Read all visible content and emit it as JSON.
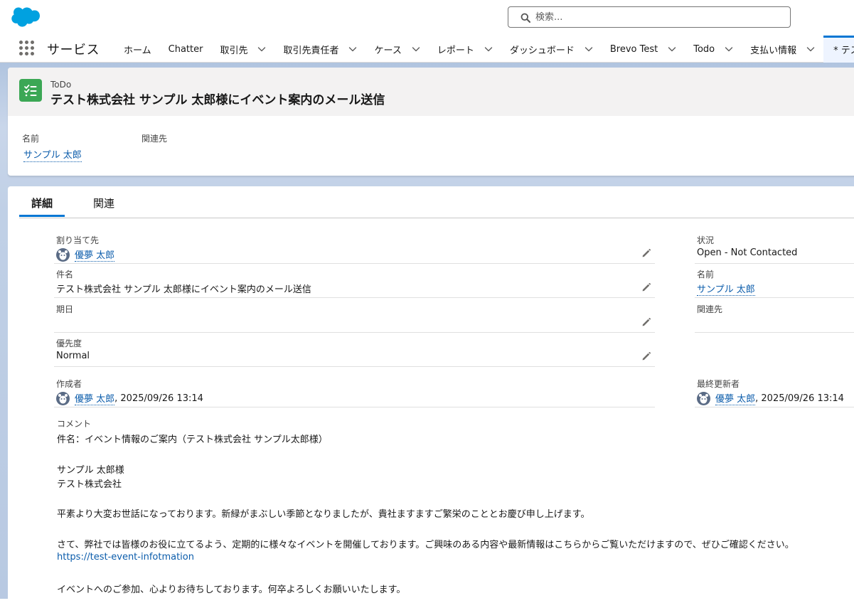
{
  "header": {
    "search_placeholder": "検索..."
  },
  "nav": {
    "app_name": "サービス",
    "items": [
      {
        "label": "ホーム",
        "dropdown": false
      },
      {
        "label": "Chatter",
        "dropdown": false
      },
      {
        "label": "取引先",
        "dropdown": true
      },
      {
        "label": "取引先責任者",
        "dropdown": true
      },
      {
        "label": "ケース",
        "dropdown": true
      },
      {
        "label": "レポート",
        "dropdown": true
      },
      {
        "label": "ダッシュボード",
        "dropdown": true
      },
      {
        "label": "Brevo Test",
        "dropdown": true
      },
      {
        "label": "Todo",
        "dropdown": true
      },
      {
        "label": "支払い情報",
        "dropdown": true
      }
    ],
    "active_tab": "* テスト"
  },
  "record": {
    "object_label": "ToDo",
    "title": "テスト株式会社 サンプル 太郎様にイベント案内のメール送信",
    "highlights": {
      "name_label": "名前",
      "name_value": "サンプル 太郎",
      "related_label": "関連先"
    }
  },
  "tabs": {
    "detail": "詳細",
    "related": "関連"
  },
  "fields": {
    "assigned_to_label": "割り当て先",
    "assigned_to_value": "優夢 太郎",
    "status_label": "状況",
    "status_value": "Open - Not Contacted",
    "subject_label": "件名",
    "subject_value": "テスト株式会社 サンプル 太郎様にイベント案内のメール送信",
    "name_label": "名前",
    "name_value": "サンプル 太郎",
    "due_date_label": "期日",
    "related_label": "関連先",
    "priority_label": "優先度",
    "priority_value": "Normal",
    "created_by_label": "作成者",
    "created_by_user": "優夢 太郎",
    "created_by_date": ", 2025/09/26 13:14",
    "modified_by_label": "最終更新者",
    "modified_by_user": "優夢 太郎",
    "modified_by_date": ", 2025/09/26 13:14"
  },
  "comment": {
    "label": "コメント",
    "lines": [
      "件名：イベント情報のご案内（テスト株式会社 サンプル太郎様）",
      "サンプル 太郎様",
      "テスト株式会社",
      "平素より大変お世話になっております。新緑がまぶしい季節となりましたが、貴社ますますご繁栄のこととお慶び申し上げます。",
      "さて、弊社では皆様のお役に立てるよう、定期的に様々なイベントを開催しております。ご興味のある内容や最新情報はこちらからご覧いただけますので、ぜひご確認ください。",
      "https://test-event-infotmation",
      "イベントへのご参加、心よりお待ちしております。何卒よろしくお願いいたします。"
    ]
  },
  "colors": {
    "brand": "#00a1e0",
    "link": "#0b5cab",
    "todo_icon": "#3ba755",
    "active_tab_border": "#0176d3"
  }
}
